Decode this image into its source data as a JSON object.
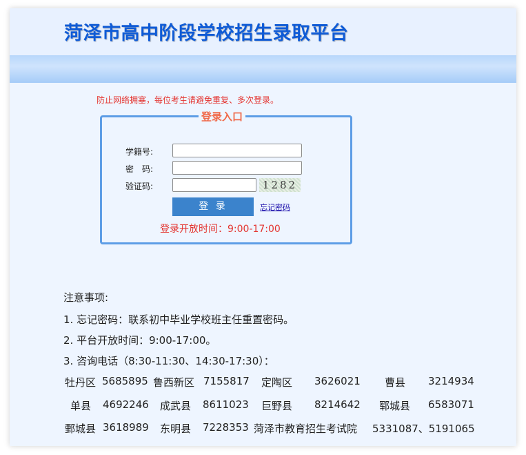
{
  "header": {
    "title": "菏泽市高中阶段学校招生录取平台"
  },
  "login": {
    "warning": "防止网络拥塞，每位考生请避免重复、多次登录。",
    "legend": "登录入口",
    "student_id_label": "学籍号:",
    "password_label": "密　码:",
    "captcha_label": "验证码:",
    "student_id_value": "",
    "password_value": "",
    "captcha_value": "",
    "captcha_text": "1282",
    "submit_label": "登 录",
    "forgot_link": "忘记密码",
    "open_time": "登录开放时间：9:00-17:00"
  },
  "notes": {
    "heading": "注意事项:",
    "items": [
      "1. 忘记密码：联系初中毕业学校班主任重置密码。",
      "2. 平台开放时间：9:00-17:00。",
      "3. 咨询电话（8:30-11:30、14:30-17:30）："
    ],
    "contacts": [
      [
        {
          "name": "牡丹区",
          "phone": "5685895"
        },
        {
          "name": "鲁西新区",
          "phone": "7155817"
        },
        {
          "name": "定陶区",
          "phone": "3626021"
        },
        {
          "name": "曹县",
          "phone": "3214934"
        }
      ],
      [
        {
          "name": "单县",
          "phone": "4692246"
        },
        {
          "name": "成武县",
          "phone": "8611023"
        },
        {
          "name": "巨野县",
          "phone": "8214642"
        },
        {
          "name": "郓城县",
          "phone": "6583071"
        }
      ],
      [
        {
          "name": "鄄城县",
          "phone": "3618989"
        },
        {
          "name": "东明县",
          "phone": "7228353"
        },
        {
          "name": "菏泽市教育招生考试院",
          "phone": "5331087、5191065"
        }
      ]
    ]
  },
  "colors": {
    "title": "#0f5bd6",
    "warning": "#e4332f",
    "legend": "#f06a4a",
    "button": "#3b83cc",
    "box_border": "#5d9de6",
    "page_bg": "#eef5ff"
  }
}
